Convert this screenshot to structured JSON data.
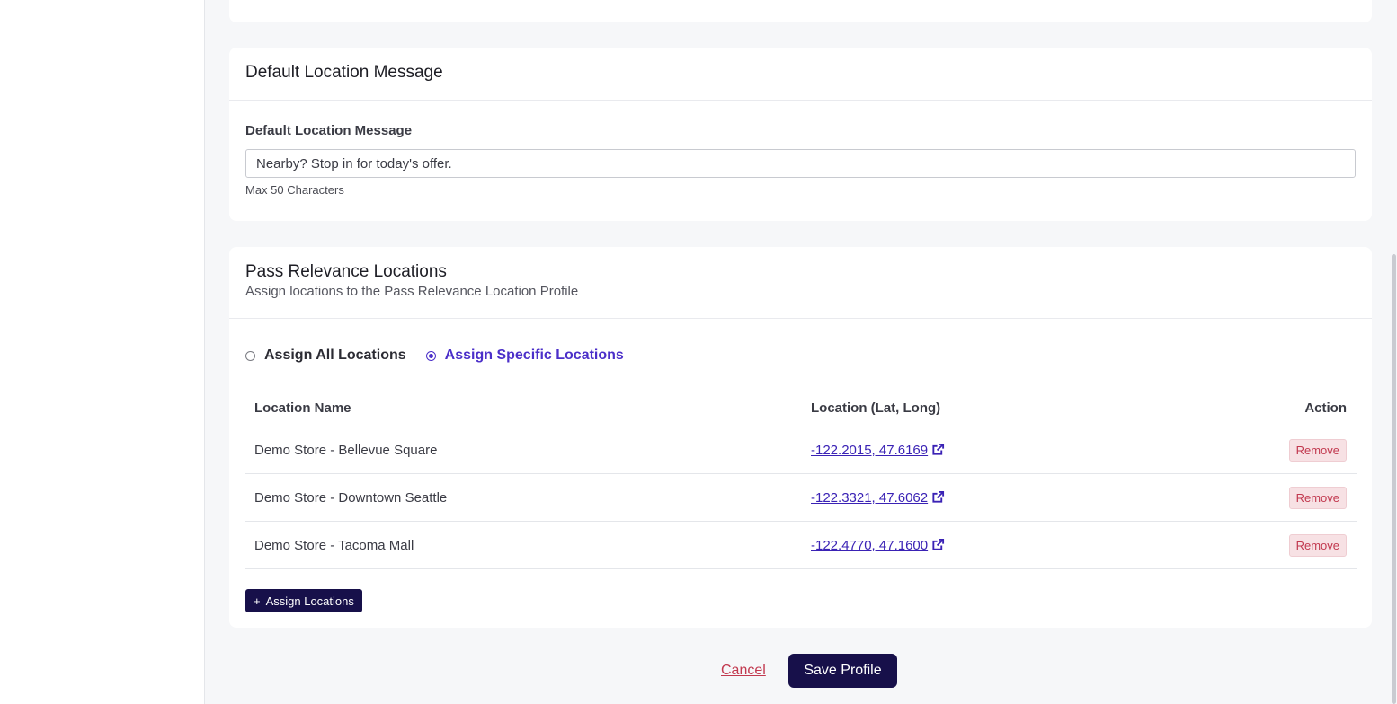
{
  "default_location": {
    "card_title": "Default Location Message",
    "field_label": "Default Location Message",
    "value": "Nearby? Stop in for today's offer.",
    "hint": "Max 50 Characters"
  },
  "relevance": {
    "card_title": "Pass Relevance Locations",
    "card_subtitle": "Assign locations to the Pass Relevance Location Profile",
    "radio_all_label": "Assign All Locations",
    "radio_specific_label": "Assign Specific Locations",
    "selected_option": "Assign Specific Locations",
    "table": {
      "headers": [
        "Location Name",
        "Location (Lat, Long)",
        "Action"
      ],
      "rows": [
        {
          "name": "Demo Store - Bellevue Square",
          "coords": "-122.2015, 47.6169",
          "action": "Remove"
        },
        {
          "name": "Demo Store - Downtown Seattle",
          "coords": "-122.3321, 47.6062",
          "action": "Remove"
        },
        {
          "name": "Demo Store - Tacoma Mall",
          "coords": "-122.4770, 47.1600",
          "action": "Remove"
        }
      ]
    },
    "assign_button_label": "Assign Locations",
    "assign_button_icon": "plus-icon"
  },
  "footer": {
    "cancel_label": "Cancel",
    "save_label": "Save Profile"
  },
  "colors": {
    "accent": "#4b2fc9",
    "primary_button": "#17104a",
    "danger": "#c2394f",
    "background": "#f6f7f9"
  }
}
